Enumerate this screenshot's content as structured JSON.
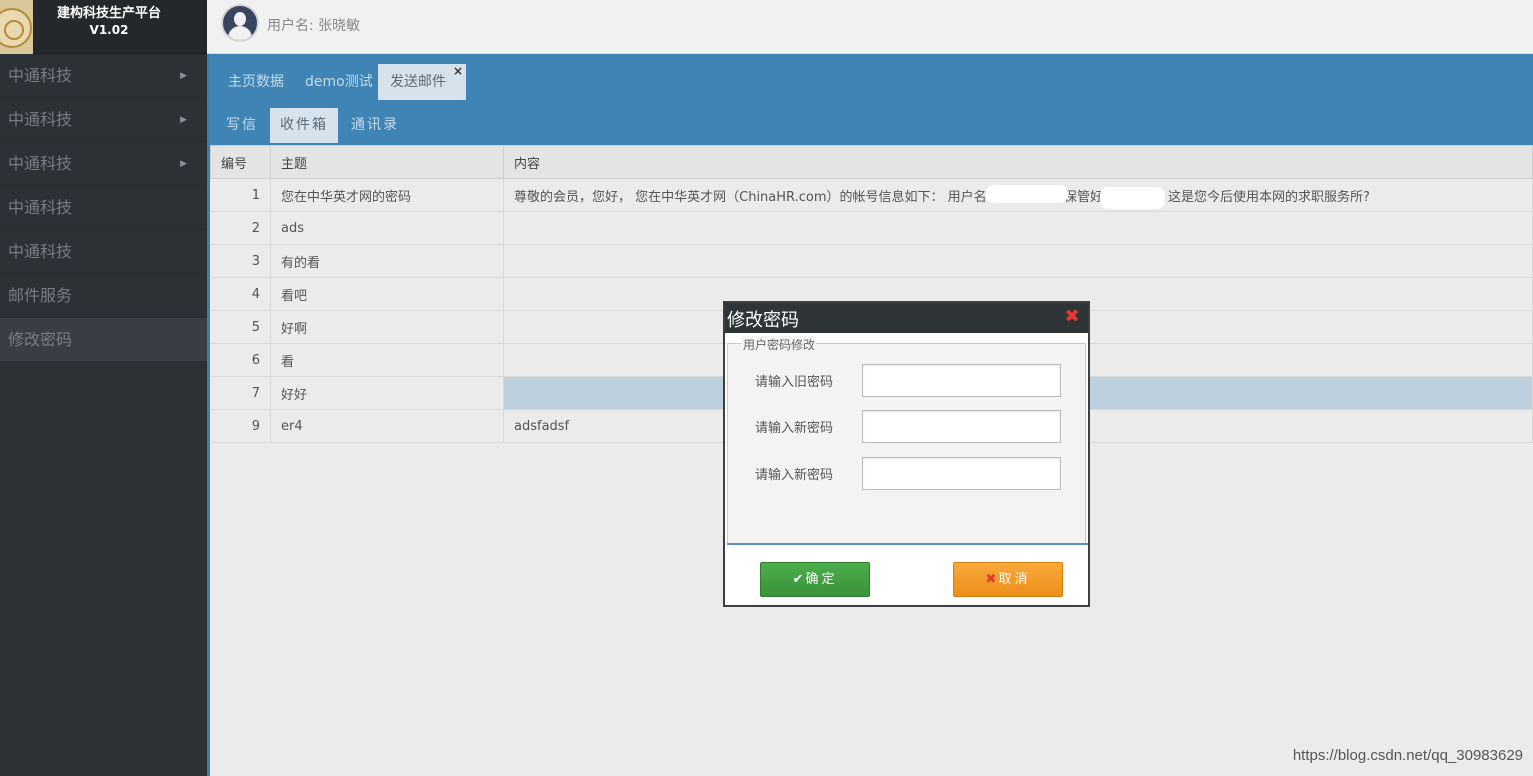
{
  "app": {
    "title": "建构科技生产平台",
    "version": "V1.02"
  },
  "sidebar": {
    "items": [
      {
        "label": "中通科技",
        "arrow": "▶"
      },
      {
        "label": "中通科技",
        "arrow": "▶"
      },
      {
        "label": "中通科技",
        "arrow": "▶"
      },
      {
        "label": "中通科技",
        "arrow": ""
      },
      {
        "label": "中通科技",
        "arrow": ""
      },
      {
        "label": "邮件服务",
        "arrow": ""
      },
      {
        "label": "修改密码",
        "arrow": ""
      }
    ]
  },
  "header": {
    "username": "用户名: 张晓敏"
  },
  "tabs": {
    "main": [
      {
        "label": "主页数据"
      },
      {
        "label": "demo测试"
      },
      {
        "label": "发送邮件"
      }
    ],
    "close": "×",
    "sub": [
      {
        "label": "写信"
      },
      {
        "label": "收件箱"
      },
      {
        "label": "通讯录"
      }
    ]
  },
  "table": {
    "headers": [
      "编号",
      "主题",
      "内容"
    ],
    "rows": [
      {
        "id": "1",
        "subject": "您在中华英才网的密码",
        "content": "尊敬的会员，您好， 您在中华英才网（ChinaHR.com）的帐号信息如下： 用户名：             密 码：              请保管好以上信息，这是您今后使用本网的求职服务所?"
      },
      {
        "id": "2",
        "subject": "ads",
        "content": ""
      },
      {
        "id": "3",
        "subject": "有的看",
        "content": ""
      },
      {
        "id": "4",
        "subject": "看吧",
        "content": ""
      },
      {
        "id": "5",
        "subject": "好啊",
        "content": ""
      },
      {
        "id": "6",
        "subject": "看",
        "content": ""
      },
      {
        "id": "7",
        "subject": "好好",
        "content": ""
      },
      {
        "id": "9",
        "subject": "er4",
        "content": "adsfadsf"
      }
    ]
  },
  "modal": {
    "title": "修改密码",
    "close": "✖",
    "legend": "用户密码修改",
    "fields": [
      {
        "label": "请输入旧密码",
        "value": ""
      },
      {
        "label": "请输入新密码",
        "value": ""
      },
      {
        "label": "请输入新密码",
        "value": ""
      }
    ],
    "ok": {
      "icon": "✔",
      "label": "确定"
    },
    "cancel": {
      "icon": "✖",
      "label": "取消"
    }
  },
  "watermark": "https://blog.csdn.net/qq_30983629",
  "colors": {
    "sidebar": "#2c3136",
    "accent": "#3e85b6",
    "ok": "#4cae4c",
    "cancel": "#f39c23"
  }
}
